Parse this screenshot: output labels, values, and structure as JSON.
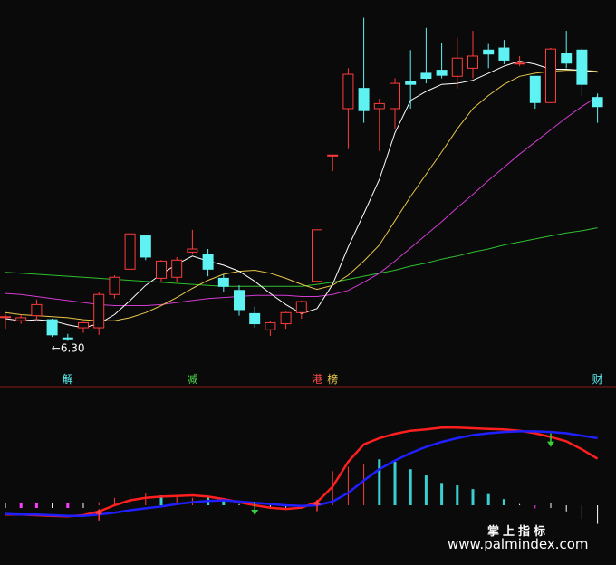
{
  "chart_data": [
    {
      "type": "candlestick",
      "panel": "price",
      "price_label": "←6.30",
      "colors": {
        "up": "#ff3b3b",
        "down": "#5ef2f2",
        "ma_fast": "#ffffff",
        "ma_mid": "#e8c74a",
        "ma_slow": "#d23bd2",
        "ma_long": "#2fbf2f",
        "separator": "#8b1a1a"
      },
      "candles": [
        {
          "o": 6.54,
          "h": 6.57,
          "l": 6.42,
          "c": 6.54
        },
        {
          "o": 6.5,
          "h": 6.56,
          "l": 6.47,
          "c": 6.53
        },
        {
          "o": 6.55,
          "h": 6.71,
          "l": 6.5,
          "c": 6.66
        },
        {
          "o": 6.51,
          "h": 6.52,
          "l": 6.34,
          "c": 6.36
        },
        {
          "o": 6.33,
          "h": 6.37,
          "l": 6.3,
          "c": 6.32
        },
        {
          "o": 6.43,
          "h": 6.49,
          "l": 6.38,
          "c": 6.48
        },
        {
          "o": 6.43,
          "h": 6.78,
          "l": 6.36,
          "c": 6.76
        },
        {
          "o": 6.76,
          "h": 6.95,
          "l": 6.72,
          "c": 6.93
        },
        {
          "o": 7.01,
          "h": 7.37,
          "l": 7.0,
          "c": 7.36
        },
        {
          "o": 7.34,
          "h": 7.34,
          "l": 7.1,
          "c": 7.13
        },
        {
          "o": 6.92,
          "h": 7.1,
          "l": 6.88,
          "c": 7.09
        },
        {
          "o": 6.93,
          "h": 7.13,
          "l": 6.88,
          "c": 7.1
        },
        {
          "o": 7.18,
          "h": 7.4,
          "l": 7.16,
          "c": 7.21
        },
        {
          "o": 7.16,
          "h": 7.21,
          "l": 6.94,
          "c": 7.01
        },
        {
          "o": 6.92,
          "h": 6.96,
          "l": 6.78,
          "c": 6.84
        },
        {
          "o": 6.8,
          "h": 6.85,
          "l": 6.55,
          "c": 6.61
        },
        {
          "o": 6.57,
          "h": 6.64,
          "l": 6.43,
          "c": 6.47
        },
        {
          "o": 6.41,
          "h": 6.5,
          "l": 6.35,
          "c": 6.48
        },
        {
          "o": 6.47,
          "h": 6.59,
          "l": 6.42,
          "c": 6.58
        },
        {
          "o": 6.58,
          "h": 6.7,
          "l": 6.52,
          "c": 6.69
        },
        {
          "o": 6.89,
          "h": 7.4,
          "l": 6.89,
          "c": 7.4
        },
        {
          "o": 8.14,
          "h": 8.14,
          "l": 7.98,
          "c": 8.14
        },
        {
          "o": 8.6,
          "h": 9.0,
          "l": 8.2,
          "c": 8.94
        },
        {
          "o": 8.8,
          "h": 9.5,
          "l": 8.46,
          "c": 8.58
        },
        {
          "o": 8.6,
          "h": 8.7,
          "l": 8.18,
          "c": 8.65
        },
        {
          "o": 8.6,
          "h": 8.9,
          "l": 8.4,
          "c": 8.85
        },
        {
          "o": 8.87,
          "h": 9.18,
          "l": 8.6,
          "c": 8.84
        },
        {
          "o": 8.95,
          "h": 9.4,
          "l": 8.85,
          "c": 8.9
        },
        {
          "o": 8.98,
          "h": 9.25,
          "l": 8.9,
          "c": 8.93
        },
        {
          "o": 8.92,
          "h": 9.3,
          "l": 8.8,
          "c": 9.1
        },
        {
          "o": 9.0,
          "h": 9.37,
          "l": 8.9,
          "c": 9.12
        },
        {
          "o": 9.18,
          "h": 9.24,
          "l": 9.0,
          "c": 9.14
        },
        {
          "o": 9.2,
          "h": 9.28,
          "l": 9.04,
          "c": 9.08
        },
        {
          "o": 9.05,
          "h": 9.12,
          "l": 9.02,
          "c": 9.05
        },
        {
          "o": 8.92,
          "h": 8.92,
          "l": 8.6,
          "c": 8.66
        },
        {
          "o": 8.66,
          "h": 9.2,
          "l": 8.66,
          "c": 9.19
        },
        {
          "o": 9.15,
          "h": 9.37,
          "l": 9.0,
          "c": 9.05
        },
        {
          "o": 9.18,
          "h": 9.2,
          "l": 8.72,
          "c": 8.84
        },
        {
          "o": 8.71,
          "h": 8.75,
          "l": 8.46,
          "c": 8.62
        }
      ],
      "ma_fast": [
        6.52,
        6.5,
        6.51,
        6.5,
        6.46,
        6.43,
        6.47,
        6.56,
        6.7,
        6.85,
        6.96,
        7.06,
        7.14,
        7.09,
        7.05,
        6.99,
        6.89,
        6.77,
        6.66,
        6.57,
        6.62,
        6.86,
        7.23,
        7.56,
        7.9,
        8.36,
        8.68,
        8.77,
        8.84,
        8.85,
        8.88,
        8.95,
        9.02,
        9.07,
        9.04,
        8.99,
        8.99,
        8.98,
        8.96
      ],
      "ma_mid": [
        6.58,
        6.56,
        6.55,
        6.54,
        6.53,
        6.51,
        6.5,
        6.5,
        6.53,
        6.58,
        6.65,
        6.73,
        6.82,
        6.9,
        6.96,
        6.99,
        7.0,
        6.97,
        6.92,
        6.86,
        6.81,
        6.85,
        6.95,
        7.09,
        7.25,
        7.49,
        7.73,
        7.95,
        8.17,
        8.4,
        8.6,
        8.73,
        8.84,
        8.92,
        8.95,
        8.97,
        8.98,
        8.98,
        8.97
      ],
      "ma_slow": [
        6.77,
        6.76,
        6.74,
        6.72,
        6.7,
        6.68,
        6.66,
        6.65,
        6.65,
        6.65,
        6.66,
        6.68,
        6.7,
        6.72,
        6.73,
        6.74,
        6.75,
        6.75,
        6.75,
        6.74,
        6.74,
        6.76,
        6.8,
        6.88,
        6.97,
        7.09,
        7.22,
        7.35,
        7.48,
        7.62,
        7.75,
        7.89,
        8.02,
        8.15,
        8.27,
        8.39,
        8.51,
        8.62,
        8.72
      ],
      "ma_long": [
        6.98,
        6.97,
        6.96,
        6.95,
        6.94,
        6.93,
        6.92,
        6.91,
        6.9,
        6.89,
        6.88,
        6.87,
        6.86,
        6.85,
        6.84,
        6.84,
        6.84,
        6.84,
        6.84,
        6.84,
        6.86,
        6.88,
        6.91,
        6.94,
        6.97,
        7.0,
        7.04,
        7.07,
        7.11,
        7.14,
        7.18,
        7.21,
        7.25,
        7.28,
        7.31,
        7.34,
        7.37,
        7.39,
        7.42
      ],
      "ylim": [
        6.0,
        9.55
      ],
      "markers": [
        {
          "index": 4,
          "label": "解",
          "color": "#5ef2f2"
        },
        {
          "index": 12,
          "label": "减",
          "color": "#49d549"
        },
        {
          "index": 20,
          "label": "港",
          "color": "#ff4a4a"
        },
        {
          "index": 21,
          "label": "榜",
          "color": "#e8c74a"
        },
        {
          "index": 38,
          "label": "财",
          "color": "#5ef2f2"
        }
      ]
    },
    {
      "type": "line",
      "panel": "indicator",
      "colors": {
        "line_a": "#ff1f1f",
        "line_b": "#1f1fff",
        "bar_pos": "#ff3b3b",
        "bar_neg": "#ff3bff",
        "bar_cyan": "#3ad0d0",
        "bar_white": "#ffffff",
        "arrow_up": "#ff3b3b",
        "arrow_down": "#3ad03a"
      },
      "series": [
        {
          "key": "line_a",
          "values": [
            -0.15,
            -0.15,
            -0.16,
            -0.17,
            -0.18,
            -0.16,
            -0.1,
            0.0,
            0.08,
            0.12,
            0.14,
            0.15,
            0.16,
            0.14,
            0.1,
            0.05,
            0.0,
            -0.04,
            -0.06,
            -0.04,
            0.05,
            0.3,
            0.7,
            0.98,
            1.08,
            1.15,
            1.2,
            1.22,
            1.25,
            1.25,
            1.24,
            1.23,
            1.22,
            1.2,
            1.16,
            1.1,
            1.03,
            0.9,
            0.75
          ]
        },
        {
          "key": "line_b",
          "values": [
            -0.14,
            -0.15,
            -0.15,
            -0.16,
            -0.17,
            -0.17,
            -0.15,
            -0.12,
            -0.08,
            -0.05,
            -0.02,
            0.02,
            0.05,
            0.07,
            0.08,
            0.06,
            0.04,
            0.02,
            0.0,
            -0.01,
            0.0,
            0.06,
            0.2,
            0.4,
            0.58,
            0.72,
            0.84,
            0.94,
            1.02,
            1.08,
            1.13,
            1.16,
            1.18,
            1.19,
            1.19,
            1.18,
            1.16,
            1.12,
            1.08
          ]
        }
      ],
      "histogram": [
        {
          "v": 0.0,
          "c": "bar_white"
        },
        {
          "v": 0.0,
          "c": "bar_neg"
        },
        {
          "v": 0.0,
          "c": "bar_neg"
        },
        {
          "v": 0.0,
          "c": "bar_white"
        },
        {
          "v": 0.0,
          "c": "bar_neg"
        },
        {
          "v": 0.0,
          "c": "bar_white"
        },
        {
          "v": 0.05,
          "c": "bar_pos"
        },
        {
          "v": 0.12,
          "c": "bar_pos"
        },
        {
          "v": 0.18,
          "c": "bar_pos"
        },
        {
          "v": 0.2,
          "c": "bar_pos"
        },
        {
          "v": 0.16,
          "c": "bar_cyan"
        },
        {
          "v": 0.14,
          "c": "bar_pos"
        },
        {
          "v": 0.12,
          "c": "bar_pos"
        },
        {
          "v": 0.14,
          "c": "bar_cyan"
        },
        {
          "v": 0.08,
          "c": "bar_cyan"
        },
        {
          "v": 0.02,
          "c": "bar_white"
        },
        {
          "v": -0.02,
          "c": "bar_white"
        },
        {
          "v": -0.03,
          "c": "bar_white"
        },
        {
          "v": -0.04,
          "c": "bar_white"
        },
        {
          "v": -0.05,
          "c": "bar_neg"
        },
        {
          "v": 0.05,
          "c": "bar_pos"
        },
        {
          "v": 0.55,
          "c": "bar_pos"
        },
        {
          "v": 0.62,
          "c": "bar_pos"
        },
        {
          "v": 0.66,
          "c": "bar_pos"
        },
        {
          "v": 0.74,
          "c": "bar_cyan"
        },
        {
          "v": 0.7,
          "c": "bar_cyan"
        },
        {
          "v": 0.58,
          "c": "bar_cyan"
        },
        {
          "v": 0.48,
          "c": "bar_cyan"
        },
        {
          "v": 0.36,
          "c": "bar_cyan"
        },
        {
          "v": 0.32,
          "c": "bar_cyan"
        },
        {
          "v": 0.26,
          "c": "bar_cyan"
        },
        {
          "v": 0.18,
          "c": "bar_cyan"
        },
        {
          "v": 0.1,
          "c": "bar_cyan"
        },
        {
          "v": 0.02,
          "c": "bar_white"
        },
        {
          "v": -0.05,
          "c": "bar_neg"
        },
        {
          "v": 0.0,
          "c": "bar_white"
        },
        {
          "v": -0.1,
          "c": "bar_white"
        },
        {
          "v": -0.22,
          "c": "bar_white"
        },
        {
          "v": -0.3,
          "c": "bar_white"
        }
      ],
      "arrows": [
        {
          "index": 6,
          "dir": "up"
        },
        {
          "index": 16,
          "dir": "down"
        },
        {
          "index": 20,
          "dir": "up"
        },
        {
          "index": 35,
          "dir": "down"
        }
      ],
      "ylim": [
        -0.35,
        1.4
      ]
    }
  ],
  "watermark": {
    "line1": "掌上指标",
    "line2": "www.palmindex.com"
  }
}
